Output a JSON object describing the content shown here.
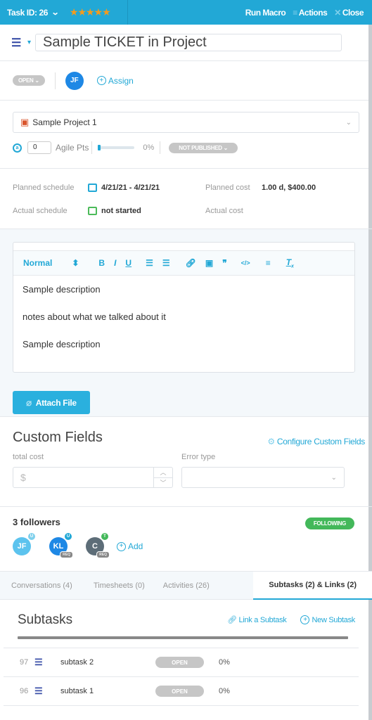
{
  "topbar": {
    "task_id": "Task ID: 26",
    "rating_stars": "★★★★★",
    "rating_value": 5,
    "run_macro": "Run Macro",
    "actions": "Actions",
    "close": "Close"
  },
  "title": {
    "task_type_icon": "checklist-icon",
    "value": "Sample TICKET in Project"
  },
  "status": {
    "status_label": "OPEN",
    "assignee_initials": "JF",
    "assign_label": "Assign"
  },
  "project": {
    "name": "Sample Project 1",
    "agile_icon": "a",
    "agile_points": "0",
    "agile_label": "Agile Pts",
    "progress_percent": 0,
    "progress_label": "0%",
    "publish_status": "NOT PUBLISHED"
  },
  "schedule": {
    "planned_label": "Planned schedule",
    "planned_value": "4/21/21 - 4/21/21",
    "actual_label": "Actual schedule",
    "actual_value": "not started",
    "planned_cost_label": "Planned cost",
    "planned_cost_value": "1.00 d, $400.00",
    "actual_cost_label": "Actual cost",
    "actual_cost_value": ""
  },
  "editor": {
    "format": "Normal",
    "toolbar": [
      "format-select",
      "bold",
      "italic",
      "underline",
      "ordered-list",
      "bullet-list",
      "link",
      "image",
      "blockquote",
      "code",
      "align",
      "clear-format"
    ],
    "paragraphs": [
      "Sample description",
      "notes about what we talked about it",
      "Sample description"
    ],
    "attach_label": "Attach File"
  },
  "custom_fields": {
    "title": "Custom Fields",
    "configure_label": "Configure Custom Fields",
    "fields": [
      {
        "label": "total cost",
        "placeholder": "$",
        "value": ""
      },
      {
        "label": "Error type",
        "value": ""
      }
    ]
  },
  "followers": {
    "count_label": "3 followers",
    "following_label": "FOLLOWING",
    "add_label": "Add",
    "list": [
      {
        "initials": "JF",
        "color": "#5cc3ee",
        "badge": "U",
        "badge_color": "#5cc3ee",
        "req": ""
      },
      {
        "initials": "KL",
        "color": "#1e88e5",
        "badge": "U",
        "badge_color": "#22a8d6",
        "req": "REQ"
      },
      {
        "initials": "C",
        "color": "#5d6d78",
        "badge": "T",
        "badge_color": "#43b85a",
        "req": "REQ"
      }
    ]
  },
  "tabs": [
    {
      "label": "Conversations (4)",
      "active": false
    },
    {
      "label": "Timesheets (0)",
      "active": false
    },
    {
      "label": "Activities (26)",
      "active": false
    },
    {
      "label": "Subtasks (2) & Links (2)",
      "active": true
    }
  ],
  "subtasks": {
    "title": "Subtasks",
    "link_label": "Link a Subtask",
    "new_label": "New Subtask",
    "rows": [
      {
        "id": "97",
        "name": "subtask 2",
        "status": "OPEN",
        "progress": "0%"
      },
      {
        "id": "96",
        "name": "subtask 1",
        "status": "OPEN",
        "progress": "0%"
      }
    ]
  },
  "colors": {
    "accent": "#22a8d6",
    "star": "#f59b1c",
    "following": "#43b85a",
    "pill_grey": "#c6c6c6"
  }
}
